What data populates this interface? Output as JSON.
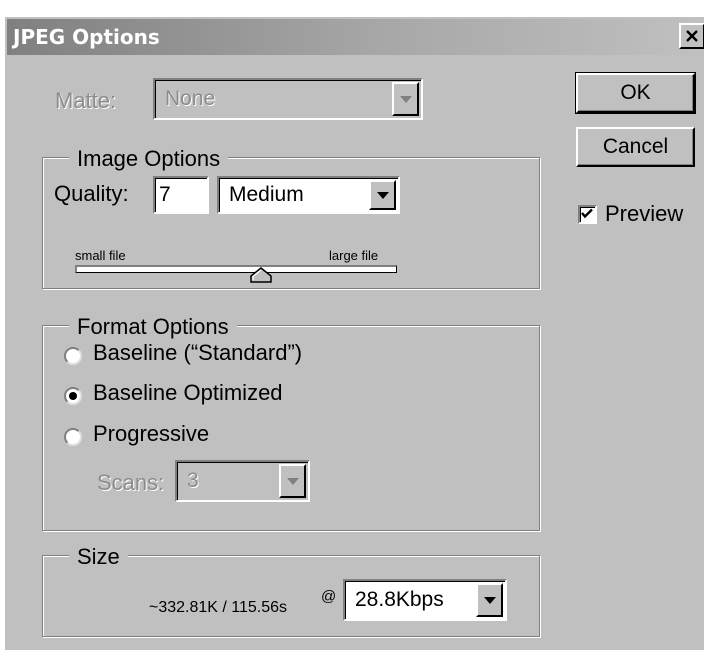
{
  "dialog": {
    "title": "JPEG Options",
    "close_glyph": "✕"
  },
  "matte": {
    "label": "Matte:",
    "value": "None",
    "enabled": false
  },
  "buttons": {
    "ok": "OK",
    "cancel": "Cancel"
  },
  "preview": {
    "label": "Preview",
    "checked": true
  },
  "image_options": {
    "title": "Image Options",
    "quality_label": "Quality:",
    "quality_value": "7",
    "quality_preset": "Medium",
    "slider_left_label": "small file",
    "slider_right_label": "large file",
    "slider_level": 7,
    "slider_max": 12
  },
  "format_options": {
    "title": "Format Options",
    "options": [
      {
        "label": "Baseline (“Standard”)",
        "selected": false
      },
      {
        "label": "Baseline Optimized",
        "selected": true
      },
      {
        "label": "Progressive",
        "selected": false
      }
    ],
    "scans_label": "Scans:",
    "scans_value": "3",
    "scans_enabled": false
  },
  "size": {
    "title": "Size",
    "estimate": "~332.81K / 115.56s",
    "at_symbol": "@",
    "speed": "28.8Kbps"
  },
  "colors": {
    "face": "#c0c0c0",
    "shadow": "#808080",
    "highlight": "#ffffff",
    "disabled_text": "#8c8c8c"
  },
  "icons": {
    "close": "close-icon",
    "dropdown": "chevron-down-icon",
    "check": "checkmark-icon",
    "slider_thumb": "slider-thumb-icon"
  }
}
